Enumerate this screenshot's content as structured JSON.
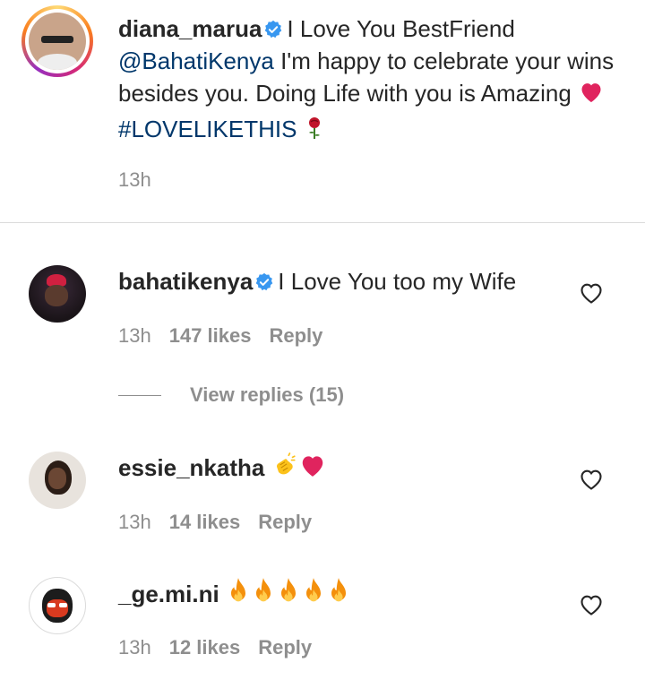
{
  "post": {
    "username": "diana_marua",
    "text_1": "I Love You BestFriend",
    "mention": "@BahatiKenya",
    "text_2": " I'm happy to celebrate your wins besides you. Doing Life with you is Amazing ",
    "hashtag": "#LOVELIKETHIS",
    "time": "13h"
  },
  "comments": [
    {
      "username": "bahatikenya",
      "verified": true,
      "text": "I Love You too my Wife",
      "time": "13h",
      "likes": "147 likes",
      "reply_label": "Reply",
      "view_replies": "View replies (15)"
    },
    {
      "username": "essie_nkatha",
      "time": "13h",
      "likes": "14 likes",
      "reply_label": "Reply"
    },
    {
      "username": "_ge.mi.ni",
      "time": "13h",
      "likes": "12 likes",
      "reply_label": "Reply"
    }
  ],
  "colors": {
    "verified_badge": "#3897f0",
    "link": "#00376b",
    "secondary_text": "#8e8e8e",
    "heart_emoji": "#e0245e",
    "story_ring": "#e1306c"
  },
  "icons": [
    "verified-badge-icon",
    "heart-outline-icon",
    "red-heart-emoji",
    "rose-emoji",
    "clapping-hands-emoji",
    "fire-emoji"
  ]
}
